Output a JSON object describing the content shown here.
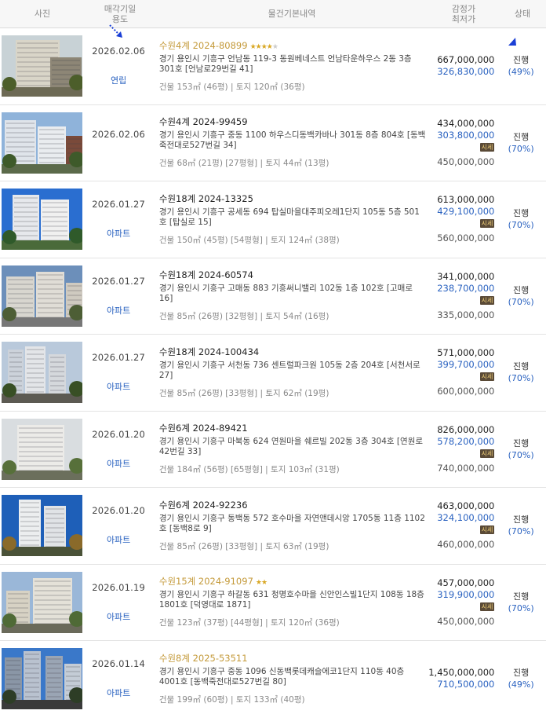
{
  "header": {
    "photo": "사진",
    "date_line1": "매각기일",
    "date_line2": "용도",
    "info": "물건기본내역",
    "price_line1": "감정가",
    "price_line2": "최저가",
    "state": "상태"
  },
  "colors": {
    "accent": "#2a62c0",
    "highlight": "#c49a3a",
    "badge_bg": "#5a4a37"
  },
  "rows": [
    {
      "date": "2026.02.06",
      "usage": "연립",
      "case": "수원4계 2024-80899",
      "highlight": true,
      "stars": "★★★★",
      "stars_off": "★",
      "addr": "경기 용인시 기흥구 언남동 119-3 동원베네스트 언남타운하우스 2동 3층 301호 [언남로29번길 41]",
      "area": "건물 153㎡ (46평)  |  토지 120㎡ (36평)",
      "appraisal": "667,000,000",
      "minimum": "326,830,000",
      "badge": "",
      "market": "",
      "status": "진행",
      "pct": "(49%)"
    },
    {
      "date": "2026.02.06",
      "usage": "",
      "case": "수원4계 2024-99459",
      "highlight": false,
      "stars": "",
      "stars_off": "",
      "addr": "경기 용인시 기흥구 중동 1100 하우스디동백카바나 301동 8층 804호 [동백죽전대로527번길 34]",
      "area": "건물 68㎡ (21평) [27평형]  |  토지 44㎡ (13평)",
      "appraisal": "434,000,000",
      "minimum": "303,800,000",
      "badge": "시세",
      "market": "450,000,000",
      "status": "진행",
      "pct": "(70%)"
    },
    {
      "date": "2026.01.27",
      "usage": "아파트",
      "case": "수원18계 2024-13325",
      "highlight": false,
      "stars": "",
      "stars_off": "",
      "addr": "경기 용인시 기흥구 공세동 694 탑실마을대주피오레1단지 105동 5층 501호 [탑실로 15]",
      "area": "건물 150㎡ (45평) [54평형]  |  토지 124㎡ (38평)",
      "appraisal": "613,000,000",
      "minimum": "429,100,000",
      "badge": "시세",
      "market": "560,000,000",
      "status": "진행",
      "pct": "(70%)"
    },
    {
      "date": "2026.01.27",
      "usage": "아파트",
      "case": "수원18계 2024-60574",
      "highlight": false,
      "stars": "",
      "stars_off": "",
      "addr": "경기 용인시 기흥구 고매동 883 기흥써니밸리 102동 1층 102호 [고매로 16]",
      "area": "건물 85㎡ (26평) [32평형]  |  토지 54㎡ (16평)",
      "appraisal": "341,000,000",
      "minimum": "238,700,000",
      "badge": "시세",
      "market": "335,000,000",
      "status": "진행",
      "pct": "(70%)"
    },
    {
      "date": "2026.01.27",
      "usage": "아파트",
      "case": "수원18계 2024-100434",
      "highlight": false,
      "stars": "",
      "stars_off": "",
      "addr": "경기 용인시 기흥구 서천동 736 센트럴파크원 105동 2층 204호 [서천서로 27]",
      "area": "건물 85㎡ (26평) [33평형]  |  토지 62㎡ (19평)",
      "appraisal": "571,000,000",
      "minimum": "399,700,000",
      "badge": "시세",
      "market": "600,000,000",
      "status": "진행",
      "pct": "(70%)"
    },
    {
      "date": "2026.01.20",
      "usage": "아파트",
      "case": "수원6계 2024-89421",
      "highlight": false,
      "stars": "",
      "stars_off": "",
      "addr": "경기 용인시 기흥구 마북동 624 연원마을 쉐르빌 202동 3층 304호 [연원로42번길 33]",
      "area": "건물 184㎡ (56평) [65평형]  |  토지 103㎡ (31평)",
      "appraisal": "826,000,000",
      "minimum": "578,200,000",
      "badge": "시세",
      "market": "740,000,000",
      "status": "진행",
      "pct": "(70%)"
    },
    {
      "date": "2026.01.20",
      "usage": "아파트",
      "case": "수원6계 2024-92236",
      "highlight": false,
      "stars": "",
      "stars_off": "",
      "addr": "경기 용인시 기흥구 동백동 572 호수마을 자연앤데시앙 1705동 11층 1102호 [동백8로 9]",
      "area": "건물 85㎡ (26평) [33평형]  |  토지 63㎡ (19평)",
      "appraisal": "463,000,000",
      "minimum": "324,100,000",
      "badge": "시세",
      "market": "460,000,000",
      "status": "진행",
      "pct": "(70%)"
    },
    {
      "date": "2026.01.19",
      "usage": "아파트",
      "case": "수원15계 2024-91097",
      "highlight": true,
      "stars": "★★",
      "stars_off": "",
      "addr": "경기 용인시 기흥구 하갈동 631 청명호수마을 신안인스빌1단지 108동 18층 1801호 [덕영대로 1871]",
      "area": "건물 123㎡ (37평) [44평형]  |  토지 120㎡ (36평)",
      "appraisal": "457,000,000",
      "minimum": "319,900,000",
      "badge": "시세",
      "market": "450,000,000",
      "status": "진행",
      "pct": "(70%)"
    },
    {
      "date": "2026.01.14",
      "usage": "아파트",
      "case": "수원8계 2025-53511",
      "highlight": true,
      "stars": "",
      "stars_off": "",
      "addr": "경기 용인시 기흥구 중동 1096 신동백롯데캐슬에코1단지 110동 40층 4001호 [동백죽전대로527번길 80]",
      "area": "건물 199㎡ (60평)  |  토지 133㎡ (40평)",
      "appraisal": "1,450,000,000",
      "minimum": "710,500,000",
      "badge": "",
      "market": "",
      "status": "진행",
      "pct": "(49%)"
    }
  ]
}
